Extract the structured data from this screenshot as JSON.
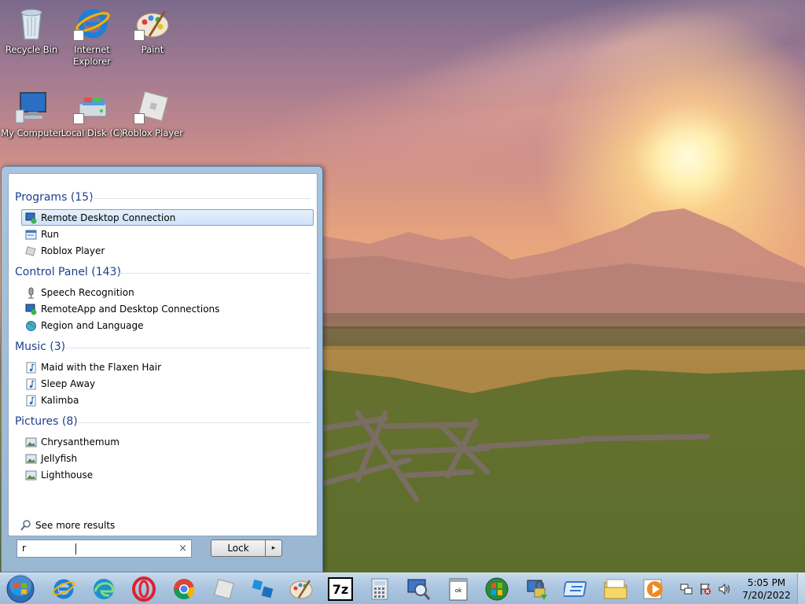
{
  "desktop": {
    "icons": [
      {
        "label": "Recycle Bin",
        "icon": "recycle-bin-icon"
      },
      {
        "label": "Internet Explorer",
        "icon": "internet-explorer-icon"
      },
      {
        "label": "Paint",
        "icon": "paint-icon"
      },
      {
        "label": "My Computer",
        "icon": "computer-icon"
      },
      {
        "label": "Local Disk (C)",
        "icon": "disk-icon"
      },
      {
        "label": "Roblox Player",
        "icon": "roblox-icon"
      }
    ]
  },
  "start_menu": {
    "groups": {
      "programs": {
        "header": "Programs (15)",
        "items": [
          "Remote Desktop Connection",
          "Run",
          "Roblox Player"
        ]
      },
      "control_panel": {
        "header": "Control Panel (143)",
        "items": [
          "Speech Recognition",
          "RemoteApp and Desktop Connections",
          "Region and Language"
        ]
      },
      "music": {
        "header": "Music (3)",
        "items": [
          "Maid with the Flaxen Hair",
          "Sleep Away",
          "Kalimba"
        ]
      },
      "pictures": {
        "header": "Pictures (8)",
        "items": [
          "Chrysanthemum",
          "Jellyfish",
          "Lighthouse"
        ]
      }
    },
    "selected_item": "Remote Desktop Connection",
    "see_more": "See more results",
    "search": {
      "value": "r",
      "clear": "×"
    },
    "power": {
      "label": "Lock",
      "arrow": "▸"
    }
  },
  "taskbar": {
    "pinned": [
      "internet-explorer-icon",
      "edge-icon",
      "opera-icon",
      "chrome-icon",
      "roblox-icon",
      "roblox-studio-icon",
      "paint-icon",
      "7zip-icon",
      "calculator-icon",
      "magnifier-icon",
      "notepad-icon",
      "windows-update-icon",
      "network-lock-icon",
      "remote-app-icon",
      "file-explorer-icon",
      "media-player-icon"
    ],
    "seven_zip_label": "7z",
    "clock": {
      "time": "5:05 PM",
      "date": "7/20/2022"
    }
  },
  "colors": {
    "accent": "#1e3e8c",
    "selection": "#cfe2f7",
    "taskbar": "#a9c4de"
  }
}
